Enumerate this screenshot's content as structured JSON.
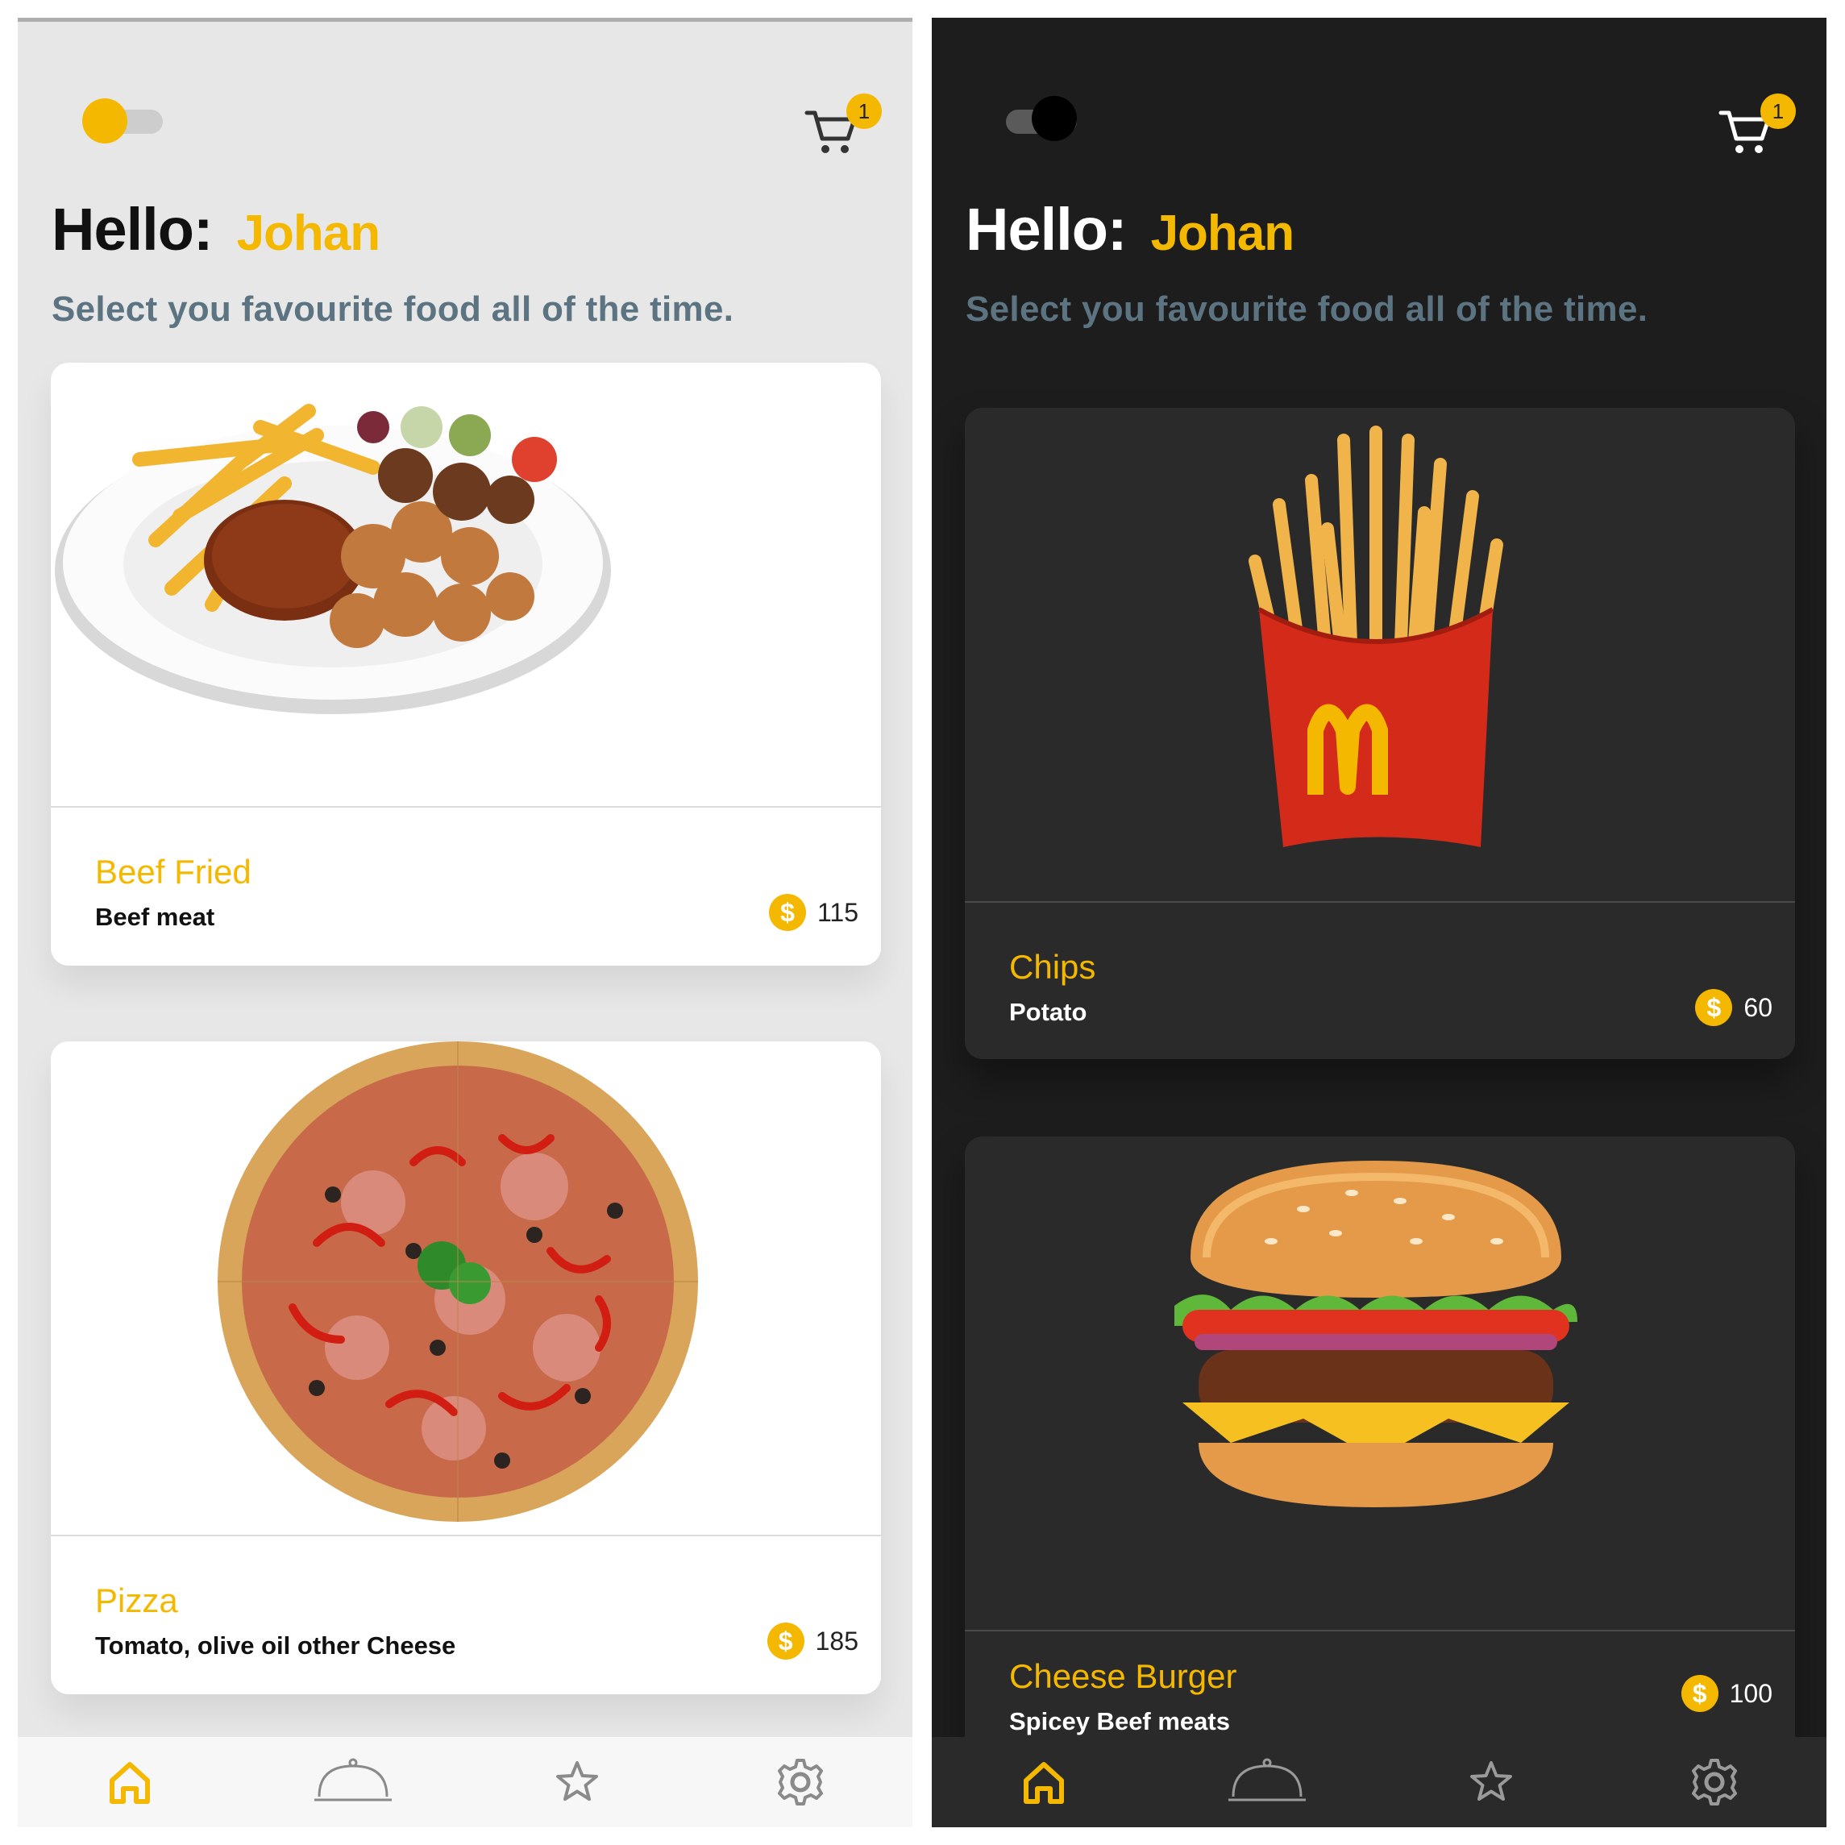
{
  "screens": [
    {
      "theme": "light",
      "cart_count": "1",
      "greeting": "Hello:",
      "user_name": "Johan",
      "tagline": "Select you favourite food all of the time.",
      "items": [
        {
          "title": "Beef Fried",
          "subtitle": "Beef meat",
          "price": "115",
          "image": "plate-of-beef-fries-and-chicken"
        },
        {
          "title": "Pizza",
          "subtitle": "Tomato, olive oil other Cheese",
          "price": "185",
          "image": "pizza"
        }
      ]
    },
    {
      "theme": "dark",
      "cart_count": "1",
      "greeting": "Hello:",
      "user_name": "Johan",
      "tagline": "Select you favourite food all of the time.",
      "items": [
        {
          "title": "Chips",
          "subtitle": "Potato",
          "price": "60",
          "image": "french-fries-box"
        },
        {
          "title": "Cheese Burger",
          "subtitle": "Spicey Beef meats",
          "price": "100",
          "image": "cheese-burger"
        }
      ]
    }
  ],
  "currency_symbol": "$",
  "nav": [
    "home-icon",
    "dish-cloche-icon",
    "star-icon",
    "settings-icon"
  ],
  "colors": {
    "accent": "#f5b800",
    "subtitle": "#5c7481",
    "light_bg": "#e7e7e7",
    "dark_bg": "#1d1d1d",
    "dark_card": "#2a2a2a"
  }
}
